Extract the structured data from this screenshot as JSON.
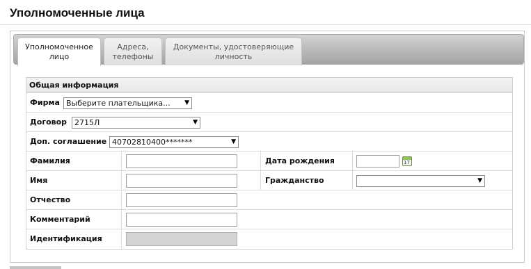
{
  "page": {
    "title": "Уполномоченные лица"
  },
  "tabs": [
    {
      "label": "Уполномоченное\nлицо",
      "active": true
    },
    {
      "label": "Адреса,\nтелефоны",
      "active": false
    },
    {
      "label": "Документы, удостоверяющие\nличность",
      "active": false
    }
  ],
  "form": {
    "header": "Общая информация",
    "firma": {
      "label": "Фирма",
      "value": "Выберите плательщика..."
    },
    "dogovor": {
      "label": "Договор",
      "value": "2715Л"
    },
    "dop": {
      "label": "Доп. соглашение",
      "value": "40702810400*******"
    },
    "familiya": {
      "label": "Фамилия",
      "value": ""
    },
    "data_rozhdeniya": {
      "label": "Дата рождения",
      "value": ""
    },
    "imya": {
      "label": "Имя",
      "value": ""
    },
    "grazhdanstvo": {
      "label": "Гражданство",
      "value": ""
    },
    "otchestvo": {
      "label": "Отчество",
      "value": ""
    },
    "kommentariy": {
      "label": "Комментарий",
      "value": ""
    },
    "identifikaciya": {
      "label": "Идентификация",
      "value": ""
    }
  },
  "icons": {
    "calendar": "calendar-icon",
    "dropdown": "chevron-down-icon"
  },
  "colors": {
    "tab_strip": "#b8b8b8",
    "disabled_field": "#d4d4d4",
    "calendar_accent": "#8fc75e"
  }
}
